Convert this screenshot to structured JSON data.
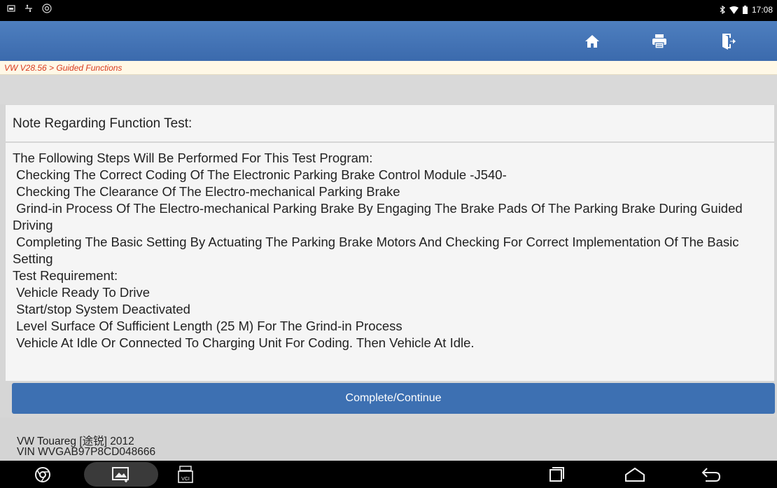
{
  "status_bar": {
    "time": "17:08",
    "left_icons": [
      "screenshot-icon",
      "usb-icon",
      "settings-circle-icon"
    ],
    "right_icons": [
      "bluetooth-icon",
      "wifi-icon",
      "battery-icon"
    ]
  },
  "header": {
    "buttons": [
      {
        "name": "home-button",
        "icon": "home-icon"
      },
      {
        "name": "print-button",
        "icon": "printer-icon"
      },
      {
        "name": "exit-button",
        "icon": "exit-icon"
      }
    ]
  },
  "breadcrumb": {
    "text": "VW V28.56 > Guided Functions"
  },
  "note": {
    "title": "Note Regarding Function Test:"
  },
  "content": {
    "lines": [
      "The Following Steps Will Be Performed For This Test Program:",
      " Checking The Correct Coding Of The Electronic Parking Brake Control Module -J540-",
      " Checking The Clearance Of The Electro-mechanical Parking Brake",
      " Grind-in Process Of The Electro-mechanical Parking Brake By Engaging The Brake Pads Of The Parking Brake During Guided Driving",
      " Completing The Basic Setting By Actuating The Parking Brake Motors And Checking For Correct Implementation Of The Basic Setting",
      "Test Requirement:",
      " Vehicle Ready To Drive",
      " Start/stop System Deactivated",
      " Level Surface Of Sufficient Length (25 M) For The Grind-in Process",
      " Vehicle At Idle Or Connected To Charging Unit For Coding. Then Vehicle At Idle."
    ]
  },
  "actions": {
    "continue_label": "Complete/Continue"
  },
  "vehicle": {
    "model": "VW Touareg [途锐] 2012",
    "vin": "VIN WVGAB97P8CD048666"
  },
  "nav_bar": {
    "items": [
      "chrome-icon",
      "gallery-icon",
      "vci-icon",
      "recent-apps-icon",
      "home-nav-icon",
      "back-icon"
    ],
    "vci_label": "VCI"
  },
  "colors": {
    "header_blue": "#3d70b2",
    "breadcrumb_red": "#d83a1e",
    "breadcrumb_bg": "#fff8e6"
  }
}
